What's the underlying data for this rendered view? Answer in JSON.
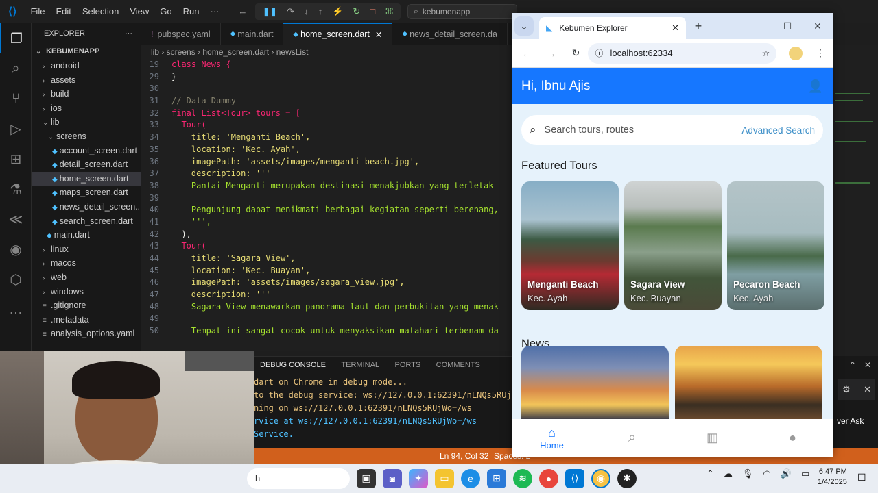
{
  "vscode": {
    "menu": [
      "File",
      "Edit",
      "Selection",
      "View",
      "Go",
      "Run",
      "···"
    ],
    "command_center": "kebumenapp",
    "explorer_title": "EXPLORER",
    "project": "KEBUMENAPP",
    "tree": [
      {
        "label": "android",
        "kind": "folder"
      },
      {
        "label": "assets",
        "kind": "folder"
      },
      {
        "label": "build",
        "kind": "folder"
      },
      {
        "label": "ios",
        "kind": "folder"
      },
      {
        "label": "lib",
        "kind": "folder-open"
      },
      {
        "label": "screens",
        "kind": "folder-open"
      },
      {
        "label": "account_screen.dart",
        "kind": "dart"
      },
      {
        "label": "detail_screen.dart",
        "kind": "dart"
      },
      {
        "label": "home_screen.dart",
        "kind": "dart",
        "selected": true
      },
      {
        "label": "maps_screen.dart",
        "kind": "dart"
      },
      {
        "label": "news_detail_screen...",
        "kind": "dart"
      },
      {
        "label": "search_screen.dart",
        "kind": "dart"
      },
      {
        "label": "main.dart",
        "kind": "dart"
      },
      {
        "label": "linux",
        "kind": "folder"
      },
      {
        "label": "macos",
        "kind": "folder"
      },
      {
        "label": "web",
        "kind": "folder"
      },
      {
        "label": "windows",
        "kind": "folder"
      },
      {
        "label": ".gitignore",
        "kind": "file"
      },
      {
        "label": ".metadata",
        "kind": "file"
      },
      {
        "label": "analysis_options.yaml",
        "kind": "file"
      }
    ],
    "tabs": [
      {
        "label": "pubspec.yaml",
        "active": false
      },
      {
        "label": "main.dart",
        "active": false
      },
      {
        "label": "home_screen.dart",
        "active": true
      },
      {
        "label": "news_detail_screen.da",
        "active": false
      }
    ],
    "breadcrumb": "lib › screens › home_screen.dart › newsList",
    "code_lines": [
      {
        "n": "19",
        "text": "class News {"
      },
      {
        "n": "29",
        "text": "}"
      },
      {
        "n": "30",
        "text": ""
      },
      {
        "n": "31",
        "text": "// Data Dummy"
      },
      {
        "n": "32",
        "text": "final List<Tour> tours = ["
      },
      {
        "n": "33",
        "text": "  Tour("
      },
      {
        "n": "34",
        "text": "    title: 'Menganti Beach',"
      },
      {
        "n": "35",
        "text": "    location: 'Kec. Ayah',"
      },
      {
        "n": "36",
        "text": "    imagePath: 'assets/images/menganti_beach.jpg',"
      },
      {
        "n": "37",
        "text": "    description: '''"
      },
      {
        "n": "38",
        "text": "    Pantai Menganti merupakan destinasi menakjubkan yang terletak"
      },
      {
        "n": "39",
        "text": ""
      },
      {
        "n": "40",
        "text": "    Pengunjung dapat menikmati berbagai kegiatan seperti berenang,"
      },
      {
        "n": "41",
        "text": "    ''',"
      },
      {
        "n": "42",
        "text": "  ),"
      },
      {
        "n": "43",
        "text": "  Tour("
      },
      {
        "n": "44",
        "text": "    title: 'Sagara View',"
      },
      {
        "n": "45",
        "text": "    location: 'Kec. Buayan',"
      },
      {
        "n": "46",
        "text": "    imagePath: 'assets/images/sagara_view.jpg',"
      },
      {
        "n": "47",
        "text": "    description: '''"
      },
      {
        "n": "48",
        "text": "    Sagara View menawarkan panorama laut dan perbukitan yang menak"
      },
      {
        "n": "49",
        "text": ""
      },
      {
        "n": "50",
        "text": "    Tempat ini sangat cocok untuk menyaksikan matahari terbenam da"
      }
    ],
    "panel_tabs": [
      "DEBUG CONSOLE",
      "TERMINAL",
      "PORTS",
      "COMMENTS"
    ],
    "console": [
      "dart on Chrome in debug mode...",
      "to the debug service: ws://127.0.0.1:62391/nLNQs5RUj",
      "ning on ws://127.0.0.1:62391/nLNQs5RUjWo=/ws",
      "rvice at ws://127.0.0.1:62391/nLNQs5RUjWo=/ws",
      " Service."
    ],
    "status_position": "Ln 94, Col 32",
    "status_spaces": "Spaces: 2",
    "ask_label": "ver Ask"
  },
  "browser": {
    "tab_title": "Kebumen Explorer",
    "url": "localhost:62334"
  },
  "app": {
    "greeting": "Hi, Ibnu Ajis",
    "search_placeholder": "Search tours, routes",
    "advanced_search": "Advanced Search",
    "featured_title": "Featured Tours",
    "tours": [
      {
        "name": "Menganti Beach",
        "location": "Kec. Ayah"
      },
      {
        "name": "Sagara View",
        "location": "Kec. Buayan"
      },
      {
        "name": "Pecaron Beach",
        "location": "Kec. Ayah"
      }
    ],
    "news_title": "News",
    "nav": [
      {
        "label": "Home",
        "icon": "home-icon",
        "active": true
      },
      {
        "label": "",
        "icon": "search-icon"
      },
      {
        "label": "",
        "icon": "map-icon"
      },
      {
        "label": "",
        "icon": "person-icon"
      }
    ],
    "accent": "#1677ff",
    "body_bg": "#e6f2fb"
  },
  "taskbar": {
    "search_text": "h",
    "time": "6:47 PM",
    "date": "1/4/2025"
  }
}
